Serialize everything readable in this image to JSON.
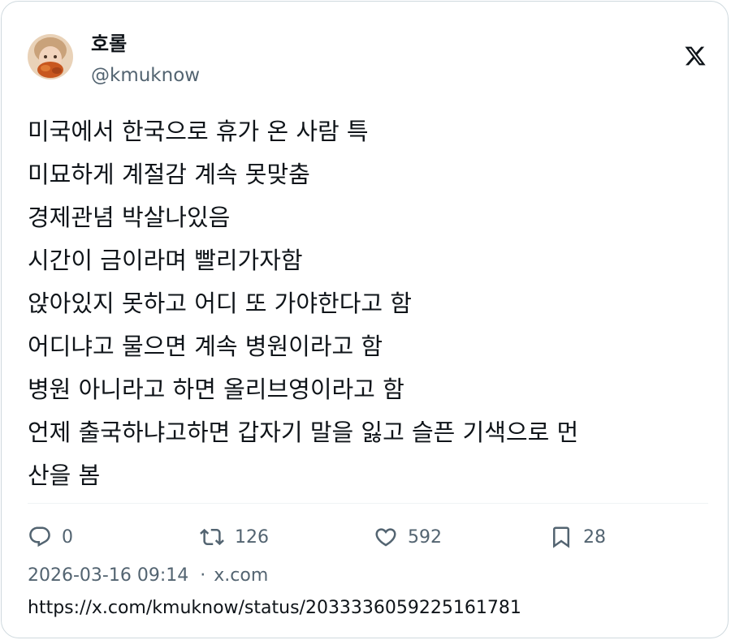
{
  "author": {
    "display_name": "호롤",
    "handle": "@kmuknow"
  },
  "platform_icon": "x-logo-icon",
  "tweet": {
    "lines": [
      "미국에서 한국으로 휴가 온 사람 특",
      "미묘하게 계절감 계속 못맞춤",
      "경제관념 박살나있음",
      "시간이 금이라며 빨리가자함",
      "앉아있지 못하고 어디 또 가야한다고 함",
      "어디냐고 물으면 계속 병원이라고 함",
      "병원 아니라고 하면 올리브영이라고 함",
      "언제 출국하냐고하면 갑자기 말을 잃고 슬픈 기색으로 먼",
      "산을 봄"
    ]
  },
  "actions": {
    "reply": {
      "icon": "reply-icon",
      "count": "0"
    },
    "retweet": {
      "icon": "retweet-icon",
      "count": "126"
    },
    "like": {
      "icon": "heart-icon",
      "count": "592"
    },
    "bookmark": {
      "icon": "bookmark-icon",
      "count": "28"
    }
  },
  "meta": {
    "timestamp": "2026-03-16 09:14",
    "separator": "·",
    "source": "x.com"
  },
  "url": "https://x.com/kmuknow/status/2033336059225161781",
  "colors": {
    "text": "#0f1419",
    "secondary": "#536471",
    "border": "#cfd9de"
  }
}
